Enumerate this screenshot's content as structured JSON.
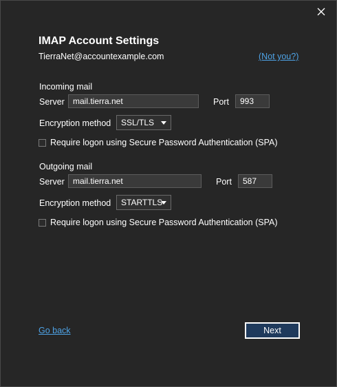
{
  "dialog": {
    "title": "IMAP Account Settings",
    "account_email": "TierraNet@accountexample.com",
    "not_you_link": "(Not you?)",
    "close_icon": "close-icon"
  },
  "incoming": {
    "heading": "Incoming mail",
    "server_label": "Server",
    "server_value": "mail.tierra.net",
    "port_label": "Port",
    "port_value": "993",
    "encryption_label": "Encryption method",
    "encryption_value": "SSL/TLS",
    "spa_label": "Require logon using Secure Password Authentication (SPA)",
    "spa_checked": false
  },
  "outgoing": {
    "heading": "Outgoing mail",
    "server_label": "Server",
    "server_value": "mail.tierra.net",
    "port_label": "Port",
    "port_value": "587",
    "encryption_label": "Encryption method",
    "encryption_value": "STARTTLS",
    "spa_label": "Require logon using Secure Password Authentication (SPA)",
    "spa_checked": false
  },
  "footer": {
    "go_back": "Go back",
    "next": "Next"
  },
  "colors": {
    "background": "#262626",
    "link": "#4ea3e6",
    "primary_button": "#1f3a5c"
  }
}
